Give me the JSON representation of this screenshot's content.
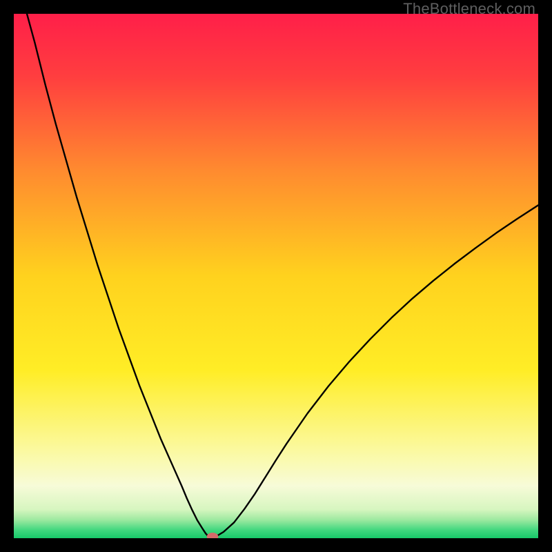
{
  "watermark": "TheBottleneck.com",
  "chart_data": {
    "type": "line",
    "title": "",
    "xlabel": "",
    "ylabel": "",
    "xlim": [
      0,
      100
    ],
    "ylim": [
      0,
      100
    ],
    "background_gradient": {
      "stops": [
        {
          "pos": 0.0,
          "color": "#ff1f49"
        },
        {
          "pos": 0.12,
          "color": "#ff3e3f"
        },
        {
          "pos": 0.3,
          "color": "#ff8b2f"
        },
        {
          "pos": 0.5,
          "color": "#ffd21e"
        },
        {
          "pos": 0.68,
          "color": "#ffed26"
        },
        {
          "pos": 0.83,
          "color": "#fbf99e"
        },
        {
          "pos": 0.9,
          "color": "#f7fbd8"
        },
        {
          "pos": 0.945,
          "color": "#d7f6c0"
        },
        {
          "pos": 0.965,
          "color": "#9de9a0"
        },
        {
          "pos": 0.985,
          "color": "#3fd77e"
        },
        {
          "pos": 1.0,
          "color": "#17c969"
        }
      ]
    },
    "series": [
      {
        "name": "bottleneck-curve",
        "color": "#000000",
        "width": 2.4,
        "x": [
          2.5,
          4,
          6,
          8,
          10,
          12,
          14,
          16,
          18,
          20,
          22,
          24,
          26,
          28,
          30,
          32,
          33,
          34,
          35,
          36,
          36.6,
          37,
          37.5,
          38,
          40,
          42,
          44,
          46,
          48,
          50,
          52,
          56,
          60,
          64,
          68,
          72,
          76,
          80,
          84,
          88,
          92,
          96,
          100
        ],
        "y": [
          100,
          94.5,
          86.5,
          79,
          72,
          65,
          58.5,
          52,
          46,
          40,
          34.5,
          29,
          24,
          19,
          14.5,
          10,
          7.6,
          5.4,
          3.4,
          1.8,
          0.9,
          0.45,
          0.15,
          0.0,
          1.2,
          3.0,
          5.6,
          8.5,
          11.7,
          14.9,
          18.0,
          23.8,
          29.0,
          33.7,
          38.0,
          42.0,
          45.7,
          49.1,
          52.3,
          55.3,
          58.2,
          60.9,
          63.5
        ]
      }
    ],
    "marker": {
      "name": "optimal-point",
      "x": 37.9,
      "y": 0.3,
      "rx": 1.1,
      "ry": 0.75,
      "color": "#d46a6a"
    }
  }
}
